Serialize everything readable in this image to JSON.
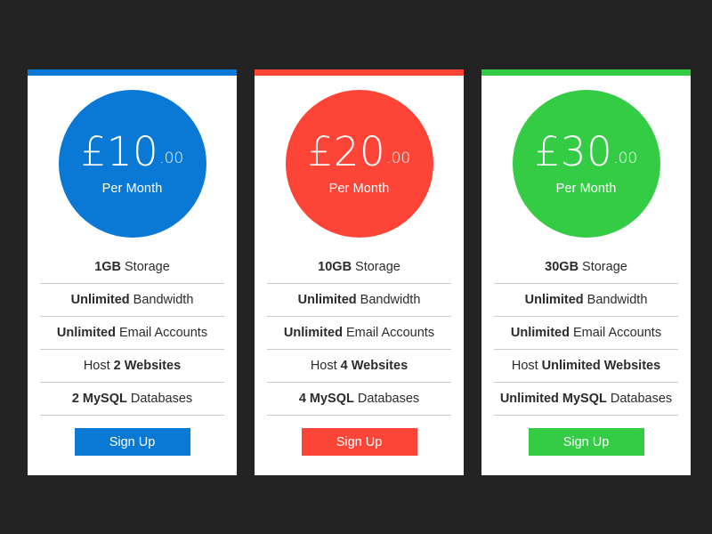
{
  "page": {
    "background_color": "#232323",
    "card_background": "#ffffff",
    "divider_color": "#c9c9c9",
    "feature_text_color": "#2b2b2b"
  },
  "plans": [
    {
      "accent_color": "#0a79d5",
      "price_symbol_amount": "£10",
      "price_cents": ".00",
      "price_period": "Per Month",
      "features": [
        {
          "bold": "1GB",
          "regular": "Storage",
          "bold_first": true
        },
        {
          "bold": "Unlimited",
          "regular": "Bandwidth",
          "bold_first": true
        },
        {
          "bold": "Unlimited",
          "regular": "Email Accounts",
          "bold_first": true
        },
        {
          "bold": "2 Websites",
          "regular": "Host",
          "bold_first": false
        },
        {
          "bold": "2 MySQL",
          "regular": "Databases",
          "bold_first": true
        }
      ],
      "cta_label": "Sign Up"
    },
    {
      "accent_color": "#fc4437",
      "price_symbol_amount": "£20",
      "price_cents": ".00",
      "price_period": "Per Month",
      "features": [
        {
          "bold": "10GB",
          "regular": "Storage",
          "bold_first": true
        },
        {
          "bold": "Unlimited",
          "regular": "Bandwidth",
          "bold_first": true
        },
        {
          "bold": "Unlimited",
          "regular": "Email Accounts",
          "bold_first": true
        },
        {
          "bold": "4 Websites",
          "regular": "Host",
          "bold_first": false
        },
        {
          "bold": "4 MySQL",
          "regular": "Databases",
          "bold_first": true
        }
      ],
      "cta_label": "Sign Up"
    },
    {
      "accent_color": "#33cc44",
      "price_symbol_amount": "£30",
      "price_cents": ".00",
      "price_period": "Per Month",
      "features": [
        {
          "bold": "30GB",
          "regular": "Storage",
          "bold_first": true
        },
        {
          "bold": "Unlimited",
          "regular": "Bandwidth",
          "bold_first": true
        },
        {
          "bold": "Unlimited",
          "regular": "Email Accounts",
          "bold_first": true
        },
        {
          "bold": "Unlimited Websites",
          "regular": "Host",
          "bold_first": false
        },
        {
          "bold": "Unlimited MySQL",
          "regular": "Databases",
          "bold_first": true
        }
      ],
      "cta_label": "Sign Up"
    }
  ]
}
